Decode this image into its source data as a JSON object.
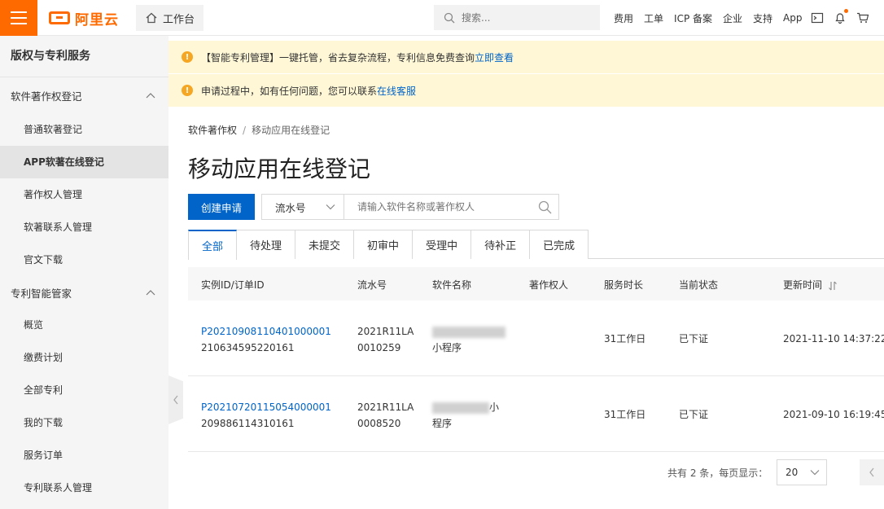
{
  "header": {
    "logo_text": "阿里云",
    "workbench_label": "工作台",
    "search_placeholder": "搜索...",
    "nav": [
      "费用",
      "工单",
      "ICP 备案",
      "企业",
      "支持",
      "App"
    ],
    "accent_color": "#ff6a00"
  },
  "sidebar": {
    "title": "版权与专利服务",
    "groups": [
      {
        "label": "软件著作权登记",
        "items": [
          "普通软著登记",
          "APP软著在线登记",
          "著作权人管理",
          "软著联系人管理",
          "官文下载"
        ]
      },
      {
        "label": "专利智能管家",
        "items": [
          "概览",
          "缴费计划",
          "全部专利",
          "我的下载",
          "服务订单",
          "专利联系人管理"
        ]
      }
    ],
    "active_item": "APP软著在线登记"
  },
  "notices": [
    {
      "text": "【智能专利管理】一键托管，省去复杂流程，专利信息免费查询 ",
      "link": "立即查看"
    },
    {
      "text": "申请过程中，如有任何问题，您可以联系",
      "link": "在线客服"
    }
  ],
  "breadcrumb": {
    "parent": "软件著作权",
    "separator": "/",
    "current": "移动应用在线登记"
  },
  "page_title": "移动应用在线登记",
  "toolbar": {
    "create_label": "创建申请",
    "filter_select": "流水号",
    "filter_placeholder": "请输入软件名称或著作权人"
  },
  "tabs": [
    "全部",
    "待处理",
    "未提交",
    "初审中",
    "受理中",
    "待补正",
    "已完成"
  ],
  "table": {
    "headers": [
      "实例ID/订单ID",
      "流水号",
      "软件名称",
      "著作权人",
      "服务时长",
      "当前状态",
      "更新时间"
    ],
    "rows": [
      {
        "instance_id": "P20210908110401000001",
        "order_id": "210634595220161",
        "serial_1": "2021R11LA",
        "serial_2": "0010259",
        "name_suffix": "小程序",
        "duration": "31工作日",
        "status": "已下证",
        "updated": "2021-11-10 14:37:22"
      },
      {
        "instance_id": "P20210720115054000001",
        "order_id": "209886114310161",
        "serial_1": "2021R11LA",
        "serial_2": "0008520",
        "name_suffix_1": "小",
        "name_suffix_2": "程序",
        "duration": "31工作日",
        "status": "已下证",
        "updated": "2021-09-10 16:19:45"
      }
    ]
  },
  "pagination": {
    "summary": "共有 2 条，每页显示：",
    "page_size": "20"
  }
}
